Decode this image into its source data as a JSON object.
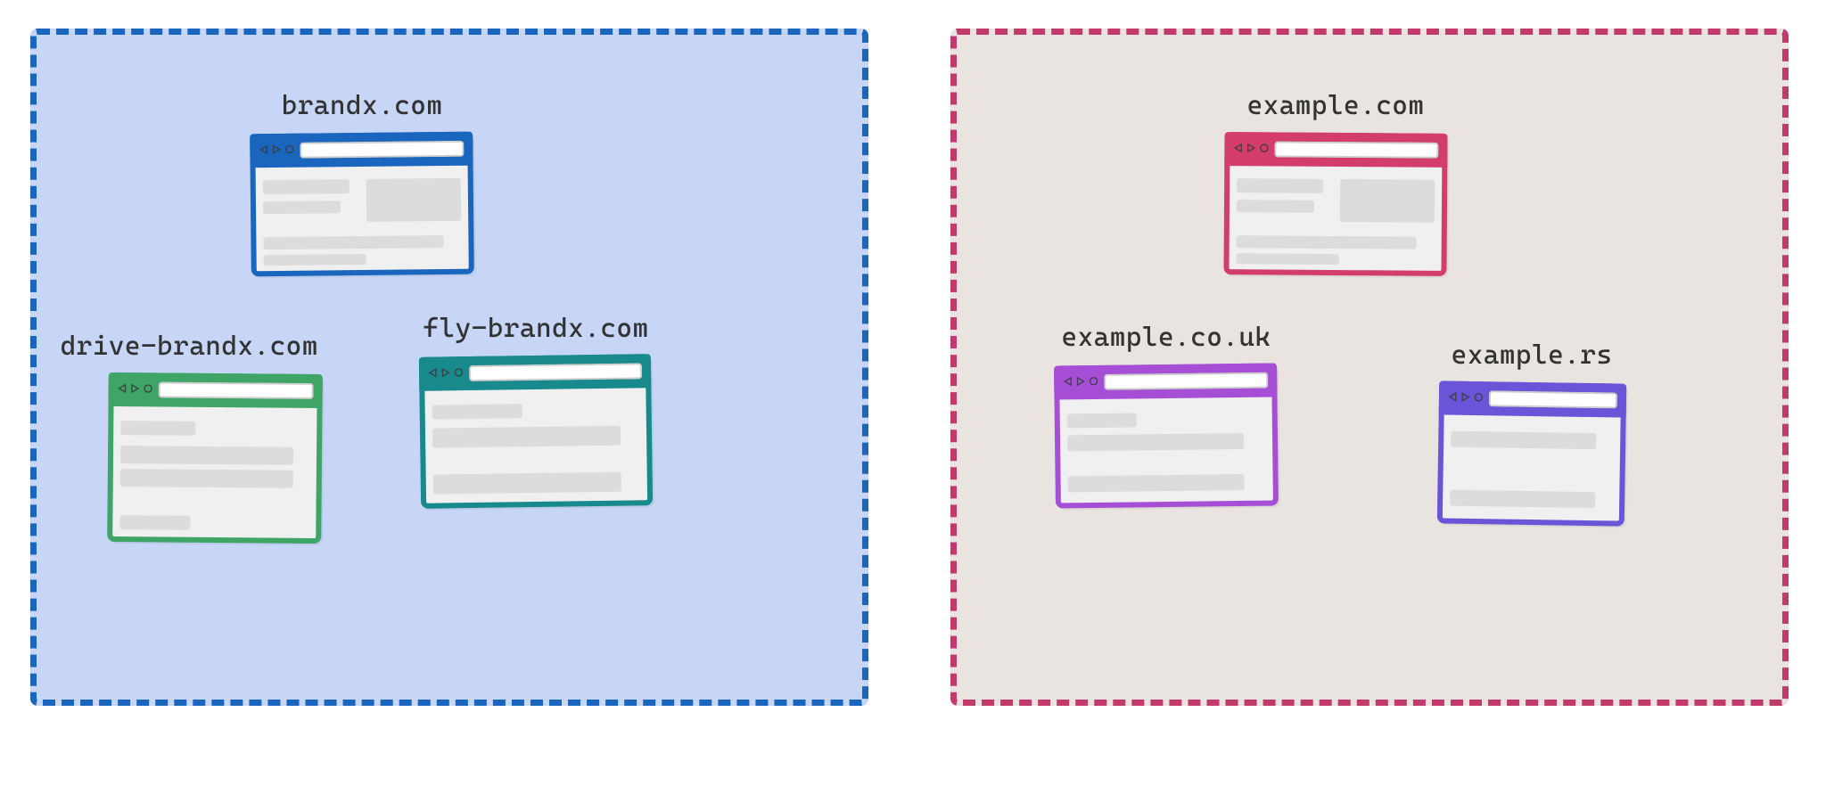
{
  "panels": {
    "left": {
      "border_color": "#1a66bf",
      "background": "#c7d5f7",
      "sites": {
        "top": {
          "label": "brandx.com",
          "color": "blue",
          "layout": "a"
        },
        "bottom_left": {
          "label": "drive-brandx.com",
          "color": "green",
          "layout": "b"
        },
        "bottom_right": {
          "label": "fly-brandx.com",
          "color": "teal",
          "layout": "c"
        }
      }
    },
    "right": {
      "border_color": "#c13a6b",
      "background": "#e9e4df",
      "sites": {
        "top": {
          "label": "example.com",
          "color": "rose",
          "layout": "a"
        },
        "bottom_left": {
          "label": "example.co.uk",
          "color": "purple",
          "layout": "d"
        },
        "bottom_right": {
          "label": "example.rs",
          "color": "indigo",
          "layout": "e"
        }
      }
    }
  },
  "nav_glyphs": {
    "back": "◁",
    "forward": "▷",
    "reload": "○"
  }
}
